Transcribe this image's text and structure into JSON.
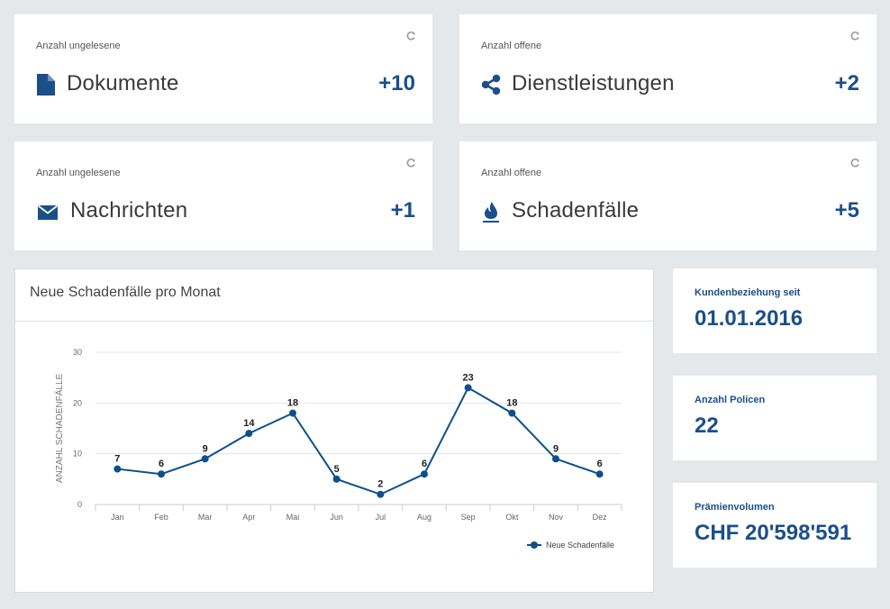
{
  "cards": [
    {
      "subtitle": "Anzahl ungelesene",
      "name": "Dokumente",
      "count": "+10",
      "icon": "document-icon"
    },
    {
      "subtitle": "Anzahl offene",
      "name": "Dienstleistungen",
      "count": "+2",
      "icon": "share-icon"
    },
    {
      "subtitle": "Anzahl ungelesene",
      "name": "Nachrichten",
      "count": "+1",
      "icon": "envelope-icon"
    },
    {
      "subtitle": "Anzahl offene",
      "name": "Schadenfälle",
      "count": "+5",
      "icon": "flame-icon"
    }
  ],
  "chart_panel": {
    "title": "Neue Schadenfälle pro Monat"
  },
  "chart_data": {
    "type": "line",
    "categories": [
      "Jan",
      "Feb",
      "Mar",
      "Apr",
      "Mai",
      "Jun",
      "Jul",
      "Aug",
      "Sep",
      "Okt",
      "Nov",
      "Dez"
    ],
    "series": [
      {
        "name": "Neue Schadenfälle",
        "values": [
          7,
          6,
          9,
          14,
          18,
          5,
          2,
          6,
          23,
          18,
          9,
          6
        ],
        "color": "#0d4f8b"
      }
    ],
    "ylabel": "ANZAHL SCHADENFÄLLE",
    "xlabel": "",
    "ylim": [
      0,
      30
    ],
    "yticks": [
      0,
      10,
      20,
      30
    ],
    "grid": true,
    "data_labels": true,
    "legend_position": "bottom-right"
  },
  "info": {
    "customer_since": {
      "label": "Kundenbeziehung seit",
      "value": "01.01.2016"
    },
    "policies": {
      "label": "Anzahl Policen",
      "value": "22"
    },
    "premium": {
      "label": "Prämienvolumen",
      "value": "CHF 20'598'591"
    }
  },
  "colors": {
    "accent": "#1a4f8a",
    "background": "#e5e8eb",
    "line": "#0d4f8b"
  }
}
